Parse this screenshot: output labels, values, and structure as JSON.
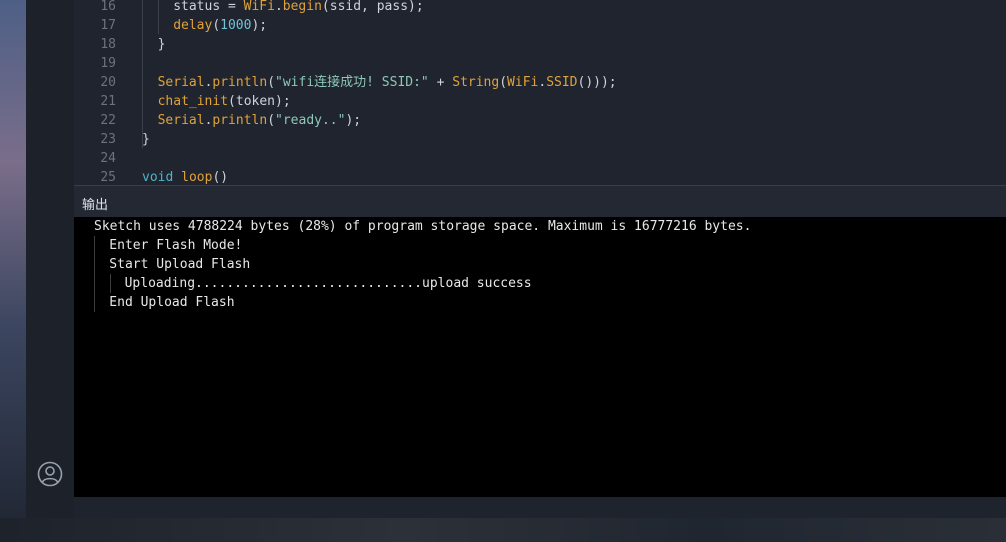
{
  "editor": {
    "lines": [
      {
        "num": "16",
        "indent": 2,
        "tokens": [
          {
            "t": "status = ",
            "c": ""
          },
          {
            "t": "WiFi",
            "c": "cls"
          },
          {
            "t": ".",
            "c": ""
          },
          {
            "t": "begin",
            "c": "fn"
          },
          {
            "t": "(ssid, pass);",
            "c": ""
          }
        ]
      },
      {
        "num": "17",
        "indent": 2,
        "tokens": [
          {
            "t": "delay",
            "c": "fn"
          },
          {
            "t": "(",
            "c": ""
          },
          {
            "t": "1000",
            "c": "num"
          },
          {
            "t": ");",
            "c": ""
          }
        ]
      },
      {
        "num": "18",
        "indent": 1,
        "tokens": [
          {
            "t": "}",
            "c": ""
          }
        ]
      },
      {
        "num": "19",
        "indent": 0,
        "tokens": []
      },
      {
        "num": "20",
        "indent": 1,
        "tokens": [
          {
            "t": "Serial",
            "c": "cls"
          },
          {
            "t": ".",
            "c": ""
          },
          {
            "t": "println",
            "c": "fn"
          },
          {
            "t": "(",
            "c": ""
          },
          {
            "t": "\"wifi连接成功! SSID:\"",
            "c": "str"
          },
          {
            "t": " + ",
            "c": ""
          },
          {
            "t": "String",
            "c": "cls"
          },
          {
            "t": "(",
            "c": ""
          },
          {
            "t": "WiFi",
            "c": "cls"
          },
          {
            "t": ".",
            "c": ""
          },
          {
            "t": "SSID",
            "c": "fn"
          },
          {
            "t": "()));",
            "c": ""
          }
        ]
      },
      {
        "num": "21",
        "indent": 1,
        "tokens": [
          {
            "t": "chat_init",
            "c": "fn"
          },
          {
            "t": "(token);",
            "c": ""
          }
        ]
      },
      {
        "num": "22",
        "indent": 1,
        "tokens": [
          {
            "t": "Serial",
            "c": "cls"
          },
          {
            "t": ".",
            "c": ""
          },
          {
            "t": "println",
            "c": "fn"
          },
          {
            "t": "(",
            "c": ""
          },
          {
            "t": "\"ready..\"",
            "c": "str"
          },
          {
            "t": ");",
            "c": ""
          }
        ]
      },
      {
        "num": "23",
        "indent": 0,
        "tokens": [
          {
            "t": "}",
            "c": ""
          }
        ]
      },
      {
        "num": "24",
        "indent": 0,
        "tokens": []
      },
      {
        "num": "25",
        "indent": 0,
        "tokens": [
          {
            "t": "void",
            "c": "kw"
          },
          {
            "t": " ",
            "c": ""
          },
          {
            "t": "loop",
            "c": "fn"
          },
          {
            "t": "()",
            "c": ""
          }
        ]
      }
    ]
  },
  "output": {
    "title": "输出",
    "lines": [
      {
        "text": "Sketch uses 4788224 bytes (28%) of program storage space. Maximum is 16777216 bytes.",
        "indent": 0
      },
      {
        "text": "Enter Flash Mode!",
        "indent": 1
      },
      {
        "text": "Start Upload Flash",
        "indent": 1
      },
      {
        "text": "Uploading.............................upload success",
        "indent": 2
      },
      {
        "text": "End Upload Flash",
        "indent": 1
      }
    ]
  },
  "activity_bar": {
    "account_icon": "account-icon"
  }
}
